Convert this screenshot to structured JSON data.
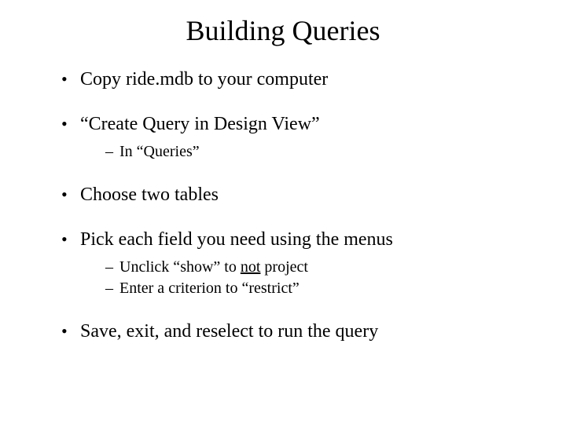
{
  "title": "Building Queries",
  "bullets": [
    {
      "text": "Copy ride.mdb to your computer"
    },
    {
      "text": "“Create Query in Design View”",
      "sub": [
        {
          "text": "In “Queries”"
        }
      ]
    },
    {
      "text": "Choose two tables"
    },
    {
      "text": "Pick each field you need using the menus",
      "sub": [
        {
          "prefix": "Unclick “show” to ",
          "underlined": "not",
          "suffix": " project"
        },
        {
          "text": "Enter a criterion to “restrict”"
        }
      ]
    },
    {
      "text": "Save, exit, and reselect to run the query"
    }
  ]
}
